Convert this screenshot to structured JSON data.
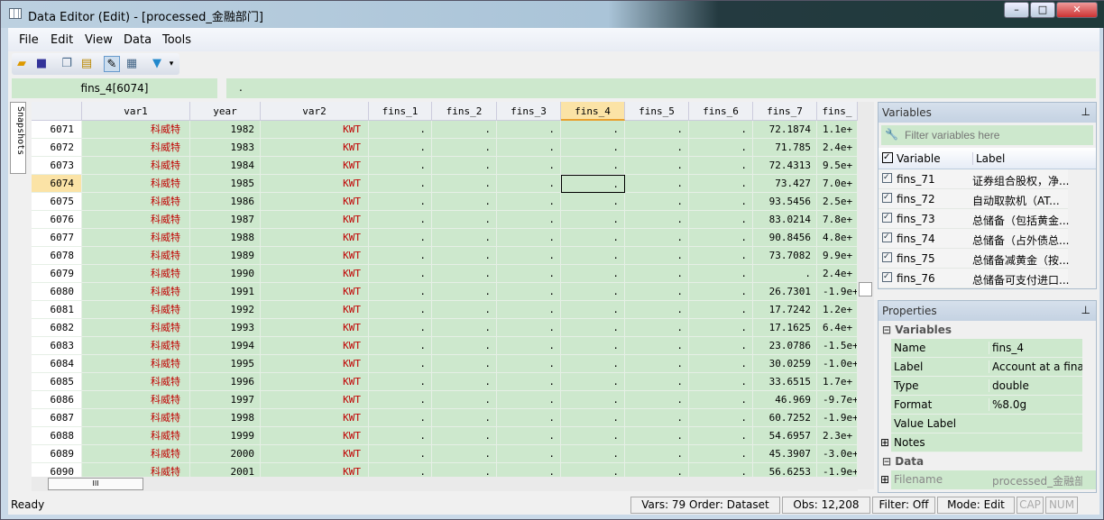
{
  "window": {
    "title": "Data Editor (Edit) - [processed_金融部门]",
    "min": "–",
    "max": "□",
    "close": "✕"
  },
  "menu": [
    "File",
    "Edit",
    "View",
    "Data",
    "Tools"
  ],
  "toolbar": [
    "open-icon",
    "save-icon",
    "copy-icon",
    "paste-icon",
    "edit-mode-icon",
    "browse-mode-icon",
    "filter-icon",
    "overflow-icon"
  ],
  "cellbar": {
    "name": "fins_4[6074]",
    "value": "."
  },
  "snapshots_label": "Snapshots",
  "grid": {
    "columns": [
      "var1",
      "year",
      "var2",
      "fins_1",
      "fins_2",
      "fins_3",
      "fins_4",
      "fins_5",
      "fins_6",
      "fins_7",
      "fins_"
    ],
    "selected_row": "6074",
    "selected_col": "fins_4",
    "rows": [
      [
        "6071",
        "科威特",
        "1982",
        "KWT",
        ".",
        ".",
        ".",
        ".",
        ".",
        ".",
        "72.1874",
        "1.1e+"
      ],
      [
        "6072",
        "科威特",
        "1983",
        "KWT",
        ".",
        ".",
        ".",
        ".",
        ".",
        ".",
        "71.785",
        "2.4e+"
      ],
      [
        "6073",
        "科威特",
        "1984",
        "KWT",
        ".",
        ".",
        ".",
        ".",
        ".",
        ".",
        "72.4313",
        "9.5e+"
      ],
      [
        "6074",
        "科威特",
        "1985",
        "KWT",
        ".",
        ".",
        ".",
        ".",
        ".",
        ".",
        "73.427",
        "7.0e+"
      ],
      [
        "6075",
        "科威特",
        "1986",
        "KWT",
        ".",
        ".",
        ".",
        ".",
        ".",
        ".",
        "93.5456",
        "2.5e+"
      ],
      [
        "6076",
        "科威特",
        "1987",
        "KWT",
        ".",
        ".",
        ".",
        ".",
        ".",
        ".",
        "83.0214",
        "7.8e+"
      ],
      [
        "6077",
        "科威特",
        "1988",
        "KWT",
        ".",
        ".",
        ".",
        ".",
        ".",
        ".",
        "90.8456",
        "4.8e+"
      ],
      [
        "6078",
        "科威特",
        "1989",
        "KWT",
        ".",
        ".",
        ".",
        ".",
        ".",
        ".",
        "73.7082",
        "9.9e+"
      ],
      [
        "6079",
        "科威特",
        "1990",
        "KWT",
        ".",
        ".",
        ".",
        ".",
        ".",
        ".",
        ".",
        "2.4e+"
      ],
      [
        "6080",
        "科威特",
        "1991",
        "KWT",
        ".",
        ".",
        ".",
        ".",
        ".",
        ".",
        "26.7301",
        "-1.9e+"
      ],
      [
        "6081",
        "科威特",
        "1992",
        "KWT",
        ".",
        ".",
        ".",
        ".",
        ".",
        ".",
        "17.7242",
        "1.2e+"
      ],
      [
        "6082",
        "科威特",
        "1993",
        "KWT",
        ".",
        ".",
        ".",
        ".",
        ".",
        ".",
        "17.1625",
        "6.4e+"
      ],
      [
        "6083",
        "科威特",
        "1994",
        "KWT",
        ".",
        ".",
        ".",
        ".",
        ".",
        ".",
        "23.0786",
        "-1.5e+"
      ],
      [
        "6084",
        "科威特",
        "1995",
        "KWT",
        ".",
        ".",
        ".",
        ".",
        ".",
        ".",
        "30.0259",
        "-1.0e+"
      ],
      [
        "6085",
        "科威特",
        "1996",
        "KWT",
        ".",
        ".",
        ".",
        ".",
        ".",
        ".",
        "33.6515",
        "1.7e+"
      ],
      [
        "6086",
        "科威特",
        "1997",
        "KWT",
        ".",
        ".",
        ".",
        ".",
        ".",
        ".",
        "46.969",
        "-9.7e+"
      ],
      [
        "6087",
        "科威特",
        "1998",
        "KWT",
        ".",
        ".",
        ".",
        ".",
        ".",
        ".",
        "60.7252",
        "-1.9e+"
      ],
      [
        "6088",
        "科威特",
        "1999",
        "KWT",
        ".",
        ".",
        ".",
        ".",
        ".",
        ".",
        "54.6957",
        "2.3e+"
      ],
      [
        "6089",
        "科威特",
        "2000",
        "KWT",
        ".",
        ".",
        ".",
        ".",
        ".",
        ".",
        "45.3907",
        "-3.0e+"
      ],
      [
        "6090",
        "科威特",
        "2001",
        "KWT",
        ".",
        ".",
        ".",
        ".",
        ".",
        ".",
        "56.6253",
        "-1.9e+"
      ]
    ]
  },
  "hscroll_label": "III",
  "variables": {
    "title": "Variables",
    "filter_placeholder": "Filter variables here",
    "col_variable": "Variable",
    "col_label": "Label",
    "items": [
      {
        "name": "fins_71",
        "label": "证券组合股权，净..."
      },
      {
        "name": "fins_72",
        "label": "自动取款机（AT..."
      },
      {
        "name": "fins_73",
        "label": "总储备（包括黄金..."
      },
      {
        "name": "fins_74",
        "label": "总储备（占外债总..."
      },
      {
        "name": "fins_75",
        "label": "总储备减黄金（按..."
      },
      {
        "name": "fins_76",
        "label": "总储备可支付进口..."
      }
    ]
  },
  "properties": {
    "title": "Properties",
    "sec_variables": "Variables",
    "sec_data": "Data",
    "rows": [
      {
        "k": "Name",
        "v": "fins_4"
      },
      {
        "k": "Label",
        "v": "Account at a finar"
      },
      {
        "k": "Type",
        "v": "double"
      },
      {
        "k": "Format",
        "v": "%8.0g"
      },
      {
        "k": "Value Label",
        "v": ""
      },
      {
        "k": "Notes",
        "v": ""
      }
    ],
    "filename": {
      "k": "Filename",
      "v": "processed_金融部"
    }
  },
  "status": {
    "ready": "Ready",
    "vars": "Vars: 79  Order: Dataset",
    "obs": "Obs: 12,208",
    "filter": "Filter: Off",
    "mode": "Mode: Edit",
    "cap": "CAP",
    "num": "NUM"
  },
  "colors": {
    "cell": "#cde8cd",
    "text_red": "#c00000",
    "selected_header": "#fbe3a6"
  }
}
